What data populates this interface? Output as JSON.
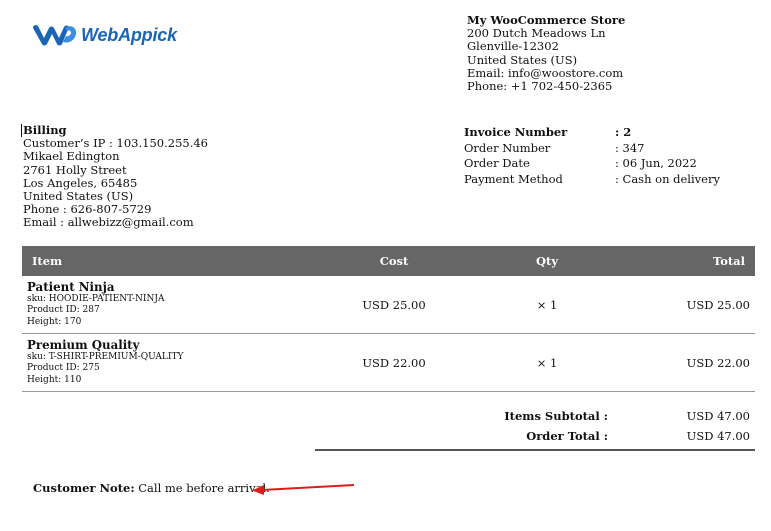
{
  "logo": {
    "text": "WebAppick",
    "icon": "webappick-logo-icon",
    "color": "#1a66b5"
  },
  "store": {
    "name": "My WooCommerce Store",
    "address1": "200 Dutch Meadows Ln",
    "address2": "Glenville-12302",
    "country": "United States (US)",
    "email": "Email: info@woostore.com",
    "phone": "Phone: +1 702-450-2365"
  },
  "billing": {
    "heading": "Billing",
    "ip": "Customer’s IP : 103.150.255.46",
    "name": "Mikael Edington",
    "street": "2761 Holly Street",
    "city": "Los Angeles, 65485",
    "country": "United States (US)",
    "phone": "Phone : 626-807-5729",
    "email": "Email : allwebizz@gmail.com"
  },
  "invoice": {
    "rows": [
      {
        "label": "Invoice Number",
        "value": ": 2"
      },
      {
        "label": "Order Number",
        "value": ": 347"
      },
      {
        "label": "Order Date",
        "value": ": 06 Jun, 2022"
      },
      {
        "label": "Payment Method",
        "value": ": Cash on delivery"
      }
    ]
  },
  "table": {
    "headers": {
      "item": "Item",
      "cost": "Cost",
      "qty": "Qty",
      "total": "Total"
    },
    "header_bg": "#666666",
    "rows": [
      {
        "name": "Patient Ninja",
        "sku": "sku: HOODIE-PATIENT-NINJA",
        "product_id": "Product ID: 287",
        "height": "Height: 170",
        "cost": "USD 25.00",
        "qty": "× 1",
        "total": "USD 25.00"
      },
      {
        "name": "Premium Quality",
        "sku": "sku: T-SHIRT-PREMIUM-QUALITY",
        "product_id": "Product ID: 275",
        "height": "Height: 110",
        "cost": "USD 22.00",
        "qty": "× 1",
        "total": "USD 22.00"
      }
    ]
  },
  "totals": {
    "subtotal_label": "Items Subtotal :",
    "subtotal_value": "USD 47.00",
    "order_total_label": "Order Total :",
    "order_total_value": "USD 47.00"
  },
  "note": {
    "label": "Customer Note:",
    "text": " Call me before arrival.",
    "arrow_color": "#e01b1b"
  }
}
